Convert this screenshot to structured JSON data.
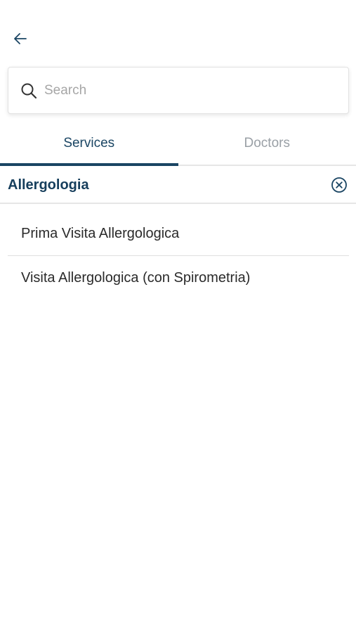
{
  "header": {
    "back_icon": "arrow-left-icon"
  },
  "search": {
    "placeholder": "Search",
    "value": "",
    "icon": "search-icon"
  },
  "tabs": [
    {
      "label": "Services",
      "active": true
    },
    {
      "label": "Doctors",
      "active": false
    }
  ],
  "filter": {
    "label": "Allergologia",
    "clear_icon": "close-circle-icon"
  },
  "services": [
    {
      "label": "Prima Visita Allergologica"
    },
    {
      "label": "Visita Allergologica (con Spirometria)"
    }
  ],
  "colors": {
    "primary": "#1a4563",
    "inactive_tab": "#9aa0a6",
    "divider": "#e6e6e6",
    "background": "#ffffff"
  }
}
